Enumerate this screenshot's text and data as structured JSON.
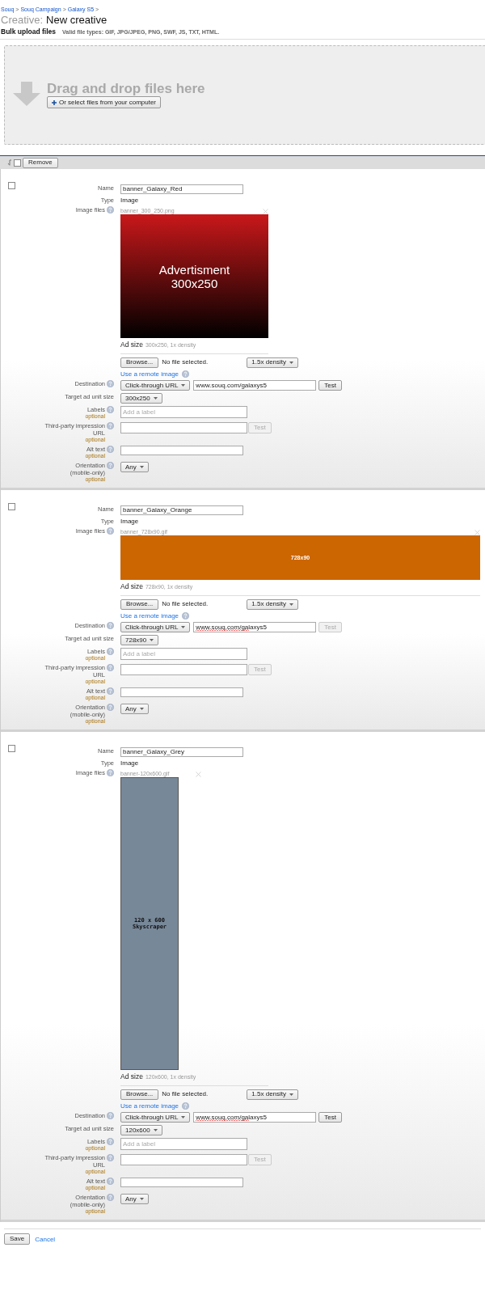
{
  "breadcrumb": {
    "separator": ">",
    "items": [
      "Souq",
      "Souq Campaign",
      "Galaxy S5"
    ]
  },
  "title": {
    "prefix": "Creative:",
    "name": "New creative"
  },
  "bulk_upload": {
    "heading": "Bulk upload files",
    "file_types": "Valid file types: GIF, JPG/JPEG, PNG, SWF, JS, TXT, HTML.",
    "drop_text": "Drag and drop files here",
    "select_button": "Or select files from your computer"
  },
  "toolbar": {
    "select_all_checked": false,
    "remove_button": "Remove"
  },
  "creatives": [
    {
      "checked": false,
      "name_label": "Name",
      "name": "banner_Galaxy_Red",
      "type_label": "Type",
      "type": "Image",
      "image_files_label": "Image files",
      "file_name": "banner_300_250.png",
      "preview": {
        "kind": "rectangle",
        "color": "#c8181a",
        "lines": [
          "Advertisment",
          "300x250"
        ]
      },
      "ad_size_label": "Ad size",
      "ad_size": "300x250, 1x density",
      "browse_button": "Browse...",
      "no_file": "No file selected.",
      "density": "1.5x density",
      "remote_link": "Use a remote image",
      "destination_label": "Destination",
      "destination_type": "Click-through URL",
      "url": "www.souq.com/galaxys5",
      "url_spellcheck": false,
      "url_test": "Test",
      "url_test_disabled": false,
      "target_label": "Target ad unit size",
      "target_size": "300x250",
      "labels_label": "Labels",
      "labels_optional": "optional",
      "labels_placeholder": "Add a label",
      "third_party_label": [
        "Third-party impression",
        "URL"
      ],
      "third_party_optional": "optional",
      "third_party_test": "Test",
      "third_party_test_disabled": true,
      "alt_label": "Alt text",
      "alt_optional": "optional",
      "orientation_label": [
        "Orientation",
        "(mobile-only)"
      ],
      "orientation_optional": "optional",
      "orientation": "Any"
    },
    {
      "checked": false,
      "name_label": "Name",
      "name": "banner_Galaxy_Orange",
      "type_label": "Type",
      "type": "Image",
      "image_files_label": "Image files",
      "file_name": "banner_728x90.gif",
      "preview": {
        "kind": "leaderboard",
        "color": "#cc6600",
        "lines": [
          "728x90"
        ]
      },
      "ad_size_label": "Ad size",
      "ad_size": "728x90, 1x density",
      "browse_button": "Browse...",
      "no_file": "No file selected.",
      "density": "1.5x density",
      "remote_link": "Use a remote image",
      "destination_label": "Destination",
      "destination_type": "Click-through URL",
      "url": "www.souq.com/galaxys5",
      "url_spellcheck": true,
      "url_test": "Test",
      "url_test_disabled": true,
      "target_label": "Target ad unit size",
      "target_size": "728x90",
      "labels_label": "Labels",
      "labels_optional": "optional",
      "labels_placeholder": "Add a label",
      "third_party_label": [
        "Third-party impression",
        "URL"
      ],
      "third_party_optional": "optional",
      "third_party_test": "Test",
      "third_party_test_disabled": true,
      "alt_label": "Alt text",
      "alt_optional": "optional",
      "orientation_label": [
        "Orientation",
        "(mobile-only)"
      ],
      "orientation_optional": "optional",
      "orientation": "Any"
    },
    {
      "checked": false,
      "name_label": "Name",
      "name": "banner_Galaxy_Grey",
      "type_label": "Type",
      "type": "Image",
      "image_files_label": "Image files",
      "file_name": "banner-120x600.gif",
      "preview": {
        "kind": "skyscraper",
        "color": "#778899",
        "lines": [
          "120 x 600",
          "Skyscraper"
        ]
      },
      "ad_size_label": "Ad size",
      "ad_size": "120x600, 1x density",
      "browse_button": "Browse...",
      "no_file": "No file selected.",
      "density": "1.5x density",
      "remote_link": "Use a remote image",
      "destination_label": "Destination",
      "destination_type": "Click-through URL",
      "url": "www.souq.com/galaxys5",
      "url_spellcheck": true,
      "url_test": "Test",
      "url_test_disabled": false,
      "target_label": "Target ad unit size",
      "target_size": "120x600",
      "labels_label": "Labels",
      "labels_optional": "optional",
      "labels_placeholder": "Add a label",
      "third_party_label": [
        "Third-party impression",
        "URL"
      ],
      "third_party_optional": "optional",
      "third_party_test": "Test",
      "third_party_test_disabled": true,
      "alt_label": "Alt text",
      "alt_optional": "optional",
      "orientation_label": [
        "Orientation",
        "(mobile-only)"
      ],
      "orientation_optional": "optional",
      "orientation": "Any"
    }
  ],
  "footer": {
    "save_button": "Save",
    "cancel_link": "Cancel"
  }
}
